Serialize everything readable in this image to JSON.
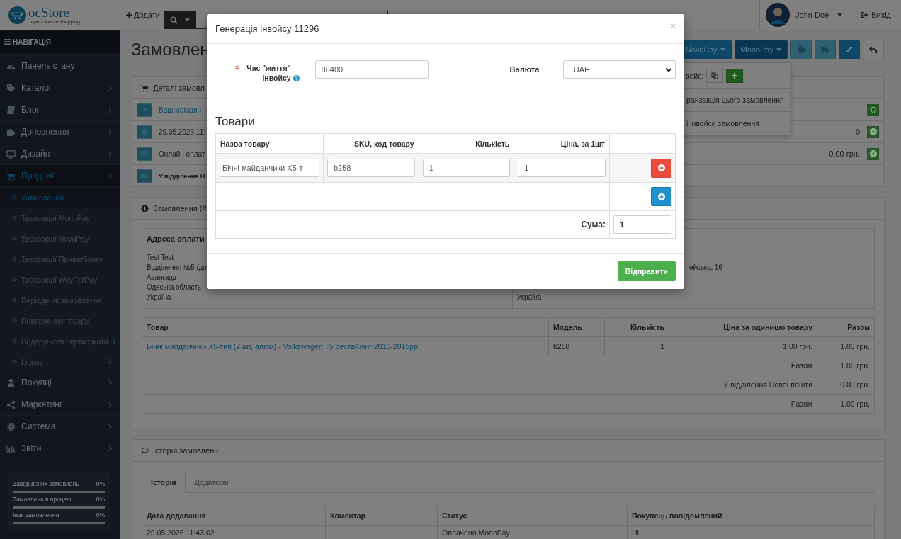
{
  "header": {
    "logo_text": "ocStore",
    "logo_tagline": "open source shopping",
    "add_button": "Додати",
    "user_name": "John Doe",
    "logout": "Вихід"
  },
  "sidebar": {
    "title": "НАВІГАЦІЯ",
    "items": [
      {
        "label": "Панель стану",
        "has_arrow": false,
        "selected": false
      },
      {
        "label": "Каталог",
        "has_arrow": true,
        "selected": false
      },
      {
        "label": "Блог",
        "has_arrow": true,
        "selected": false
      },
      {
        "label": "Доповнення",
        "has_arrow": true,
        "selected": false
      },
      {
        "label": "Дизайн",
        "has_arrow": true,
        "selected": false
      },
      {
        "label": "Продажі",
        "has_arrow": true,
        "selected": true,
        "children": [
          {
            "label": "Замовлення",
            "has_arrow": false,
            "selected": true
          },
          {
            "label": "Транзакції MonoPay",
            "has_arrow": false,
            "selected": false
          },
          {
            "label": "Транзакції NovaPay",
            "has_arrow": false,
            "selected": false
          },
          {
            "label": "Транзакції Приватбанку",
            "has_arrow": false,
            "selected": false
          },
          {
            "label": "Транзакції WayForPay",
            "has_arrow": false,
            "selected": false
          },
          {
            "label": "Періодичні замовлення",
            "has_arrow": false,
            "selected": false
          },
          {
            "label": "Повернення товару",
            "has_arrow": false,
            "selected": false
          },
          {
            "label": "Подарункові сертифікати",
            "has_arrow": true,
            "selected": false
          },
          {
            "label": "Liqpay",
            "has_arrow": true,
            "selected": false
          }
        ]
      },
      {
        "label": "Покупці",
        "has_arrow": true,
        "selected": false
      },
      {
        "label": "Маркетинг",
        "has_arrow": true,
        "selected": false
      },
      {
        "label": "Система",
        "has_arrow": true,
        "selected": false
      },
      {
        "label": "Звіти",
        "has_arrow": true,
        "selected": false
      }
    ],
    "stats": [
      {
        "label": "Завершених замовлень",
        "value": "0%",
        "level": 0
      },
      {
        "label": "Замовлень в процесі",
        "value": "0%",
        "level": 0
      },
      {
        "label": "Інші замовлення",
        "value": "0%",
        "level": 0
      }
    ]
  },
  "page": {
    "title": "Замовлен",
    "payment_buttons": [
      {
        "label": "NovaPay",
        "selected": false
      },
      {
        "label": "MonoPay",
        "selected": true
      }
    ]
  },
  "monopay_menu": {
    "invoice_label": "войс:",
    "items": [
      "ранзакція цього замовлення",
      "і інвойси замовлення"
    ]
  },
  "order_details": {
    "title": "Деталі замовл",
    "rows": [
      {
        "kind": "link",
        "text": "Ваш магазин"
      },
      {
        "kind": "text",
        "text": "29.05.2026 11:"
      },
      {
        "kind": "text",
        "text": "Онлайн оплат"
      },
      {
        "kind": "bold",
        "text": "У відділення Н"
      }
    ]
  },
  "options_panel": {
    "rows": [
      {
        "kind": "gear"
      },
      {
        "kind": "add",
        "value": "0"
      },
      {
        "kind": "add",
        "value": "0.00 грн."
      }
    ]
  },
  "order_panel": {
    "title": "Замовлення (#",
    "address": {
      "heading": "Адреса оплати",
      "payment_lines": [
        "Test Test",
        "Відділення №5 (до",
        "Авангард",
        "Одеська область",
        "Україна"
      ],
      "shipping_fragment": "ейська, 16",
      "shipping_country": "Україна"
    },
    "products": {
      "columns": [
        "Товар",
        "Модель",
        "Кількість",
        "Ціна за одиницю товару",
        "Разом"
      ],
      "rows": [
        {
          "product": "Бічні майданчики X5-тип (2 шт, алюм) - Volkswagen T5 рестайлінг 2010-2015рр.",
          "model": "b258",
          "quantity": "1",
          "price": "1.00 грн.",
          "total": "1.00 грн."
        }
      ],
      "totals": [
        {
          "label": "Разом",
          "value": "1.00 грн."
        },
        {
          "label": "У відділення Нової пошти",
          "value": "0.00 грн."
        },
        {
          "label": "Разом",
          "value": "1.00 грн."
        }
      ]
    }
  },
  "history": {
    "title": "Історія замовлень",
    "tabs": [
      {
        "label": "Історія",
        "selected": true
      },
      {
        "label": "Додаткові",
        "selected": false
      }
    ],
    "columns": [
      "Дата додавання",
      "Коментар",
      "Статус",
      "Покупець повідомлений"
    ],
    "rows": [
      {
        "date": "29.05.2026 11:43:02",
        "status": "Оплачено MonoPay",
        "notified": "Ні"
      }
    ]
  },
  "modal": {
    "title": "Генерація інвойсу 11296",
    "lifetime_label": "Час \"життя\" інвойсу",
    "required": true,
    "lifetime_value": "86400",
    "currency_label": "Валюта",
    "currency_value": "UAH",
    "section_title": "Товари",
    "columns": [
      "Назва товару",
      "SKU, код товару",
      "Кількість",
      "Ціна, за 1шт"
    ],
    "items": [
      {
        "name": "Бічні майданчики X5-т",
        "sku": "b258",
        "quantity": "1",
        "price": "1"
      }
    ],
    "sum_label": "Сума:",
    "sum_value": "1",
    "submit": "Відправити"
  }
}
